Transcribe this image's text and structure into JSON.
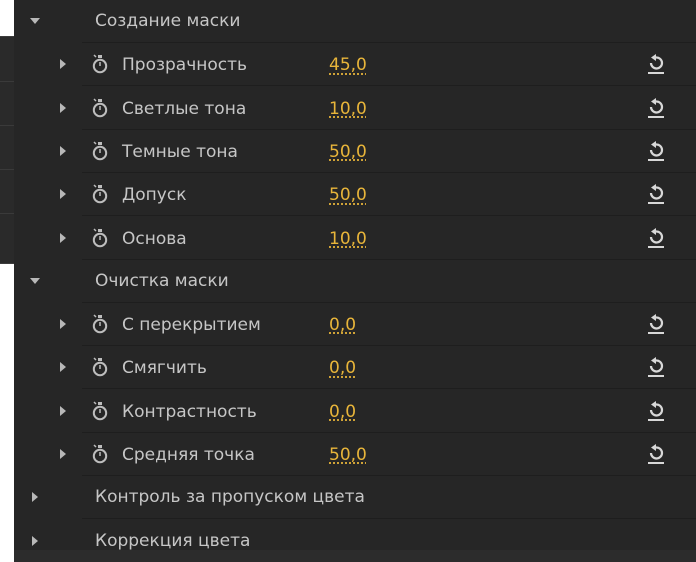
{
  "sections": [
    {
      "label": "Создание маски",
      "expanded": true,
      "params": [
        {
          "label": "Прозрачность",
          "value": "45,0"
        },
        {
          "label": "Светлые тона",
          "value": "10,0"
        },
        {
          "label": "Темные тона",
          "value": "50,0"
        },
        {
          "label": "Допуск",
          "value": "50,0"
        },
        {
          "label": "Основа",
          "value": "10,0"
        }
      ]
    },
    {
      "label": "Очистка маски",
      "expanded": true,
      "params": [
        {
          "label": "С перекрытием",
          "value": "0,0"
        },
        {
          "label": "Смягчить",
          "value": "0,0"
        },
        {
          "label": "Контрастность",
          "value": "0,0"
        },
        {
          "label": "Средняя точка",
          "value": "50,0"
        }
      ]
    },
    {
      "label": "Контроль за пропуском цвета",
      "expanded": false,
      "params": []
    },
    {
      "label": "Коррекция цвета",
      "expanded": false,
      "params": []
    }
  ],
  "icons": {
    "expanded": "triangle-down-icon",
    "collapsed": "triangle-right-icon",
    "stopwatch": "stopwatch-icon",
    "reset": "reset-icon"
  },
  "colors": {
    "panel_bg": "#262626",
    "value": "#e8b53a",
    "text": "#c6c6c6"
  }
}
